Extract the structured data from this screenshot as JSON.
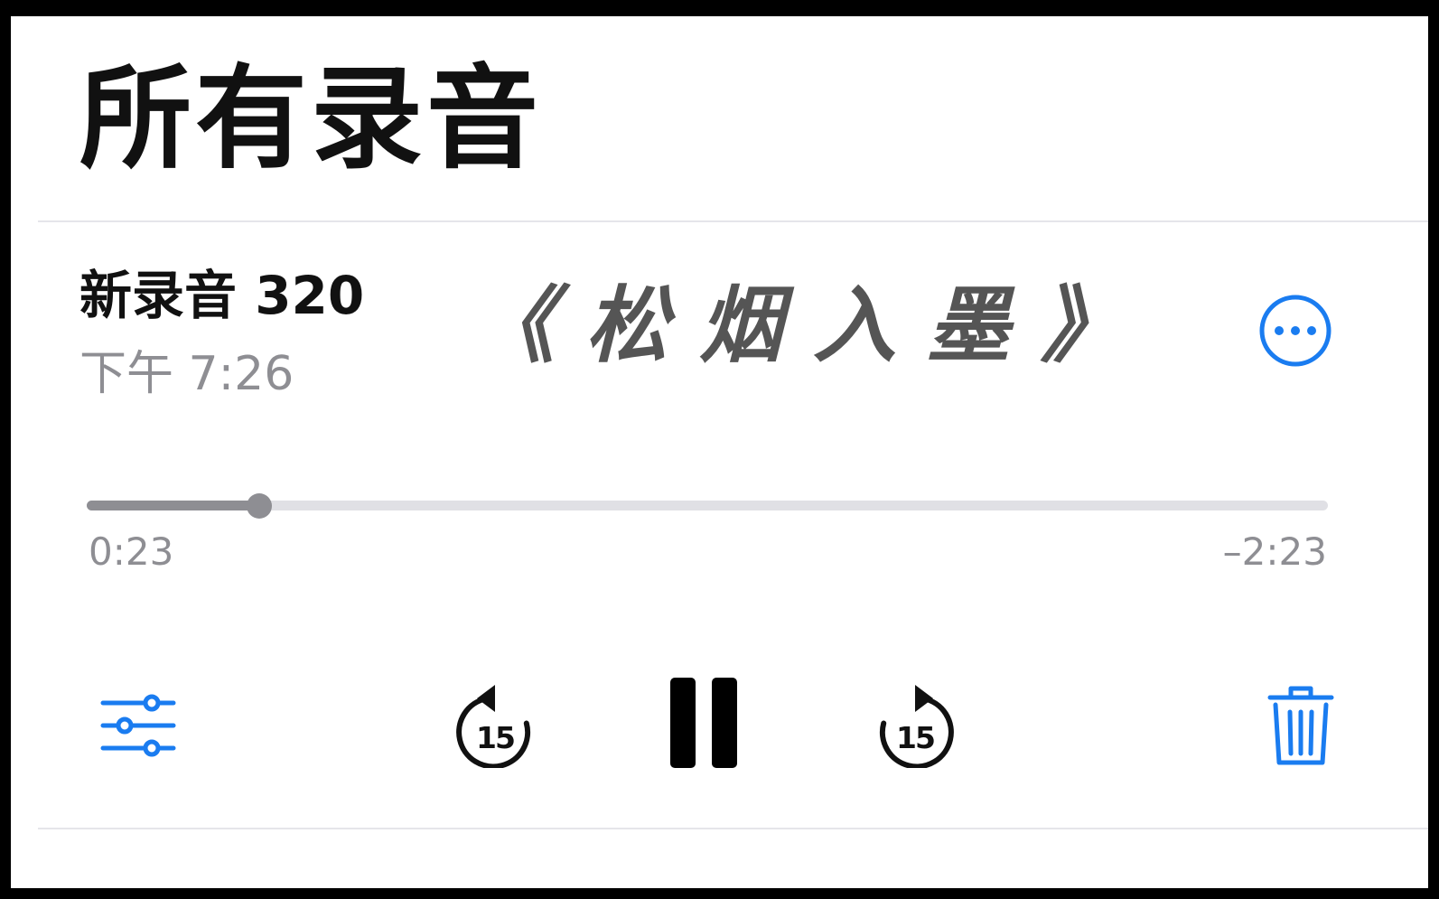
{
  "header": {
    "title": "所有录音"
  },
  "recording": {
    "name": "新录音 320",
    "time": "下午 7:26",
    "overlay_title": "《松烟入墨》"
  },
  "playback": {
    "elapsed": "0:23",
    "remaining": "–2:23",
    "progress_fraction": 0.139
  },
  "controls": {
    "skip_back_seconds": "15",
    "skip_forward_seconds": "15",
    "icons": {
      "more": "more-ellipsis-icon",
      "edit": "sliders-icon",
      "skip_back": "rotate-back-icon",
      "pause": "pause-icon",
      "skip_forward": "rotate-forward-icon",
      "delete": "trash-icon"
    }
  },
  "colors": {
    "accent": "#1a7cf0",
    "secondary_text": "#8e8e93",
    "track": "#e0e0e5"
  }
}
